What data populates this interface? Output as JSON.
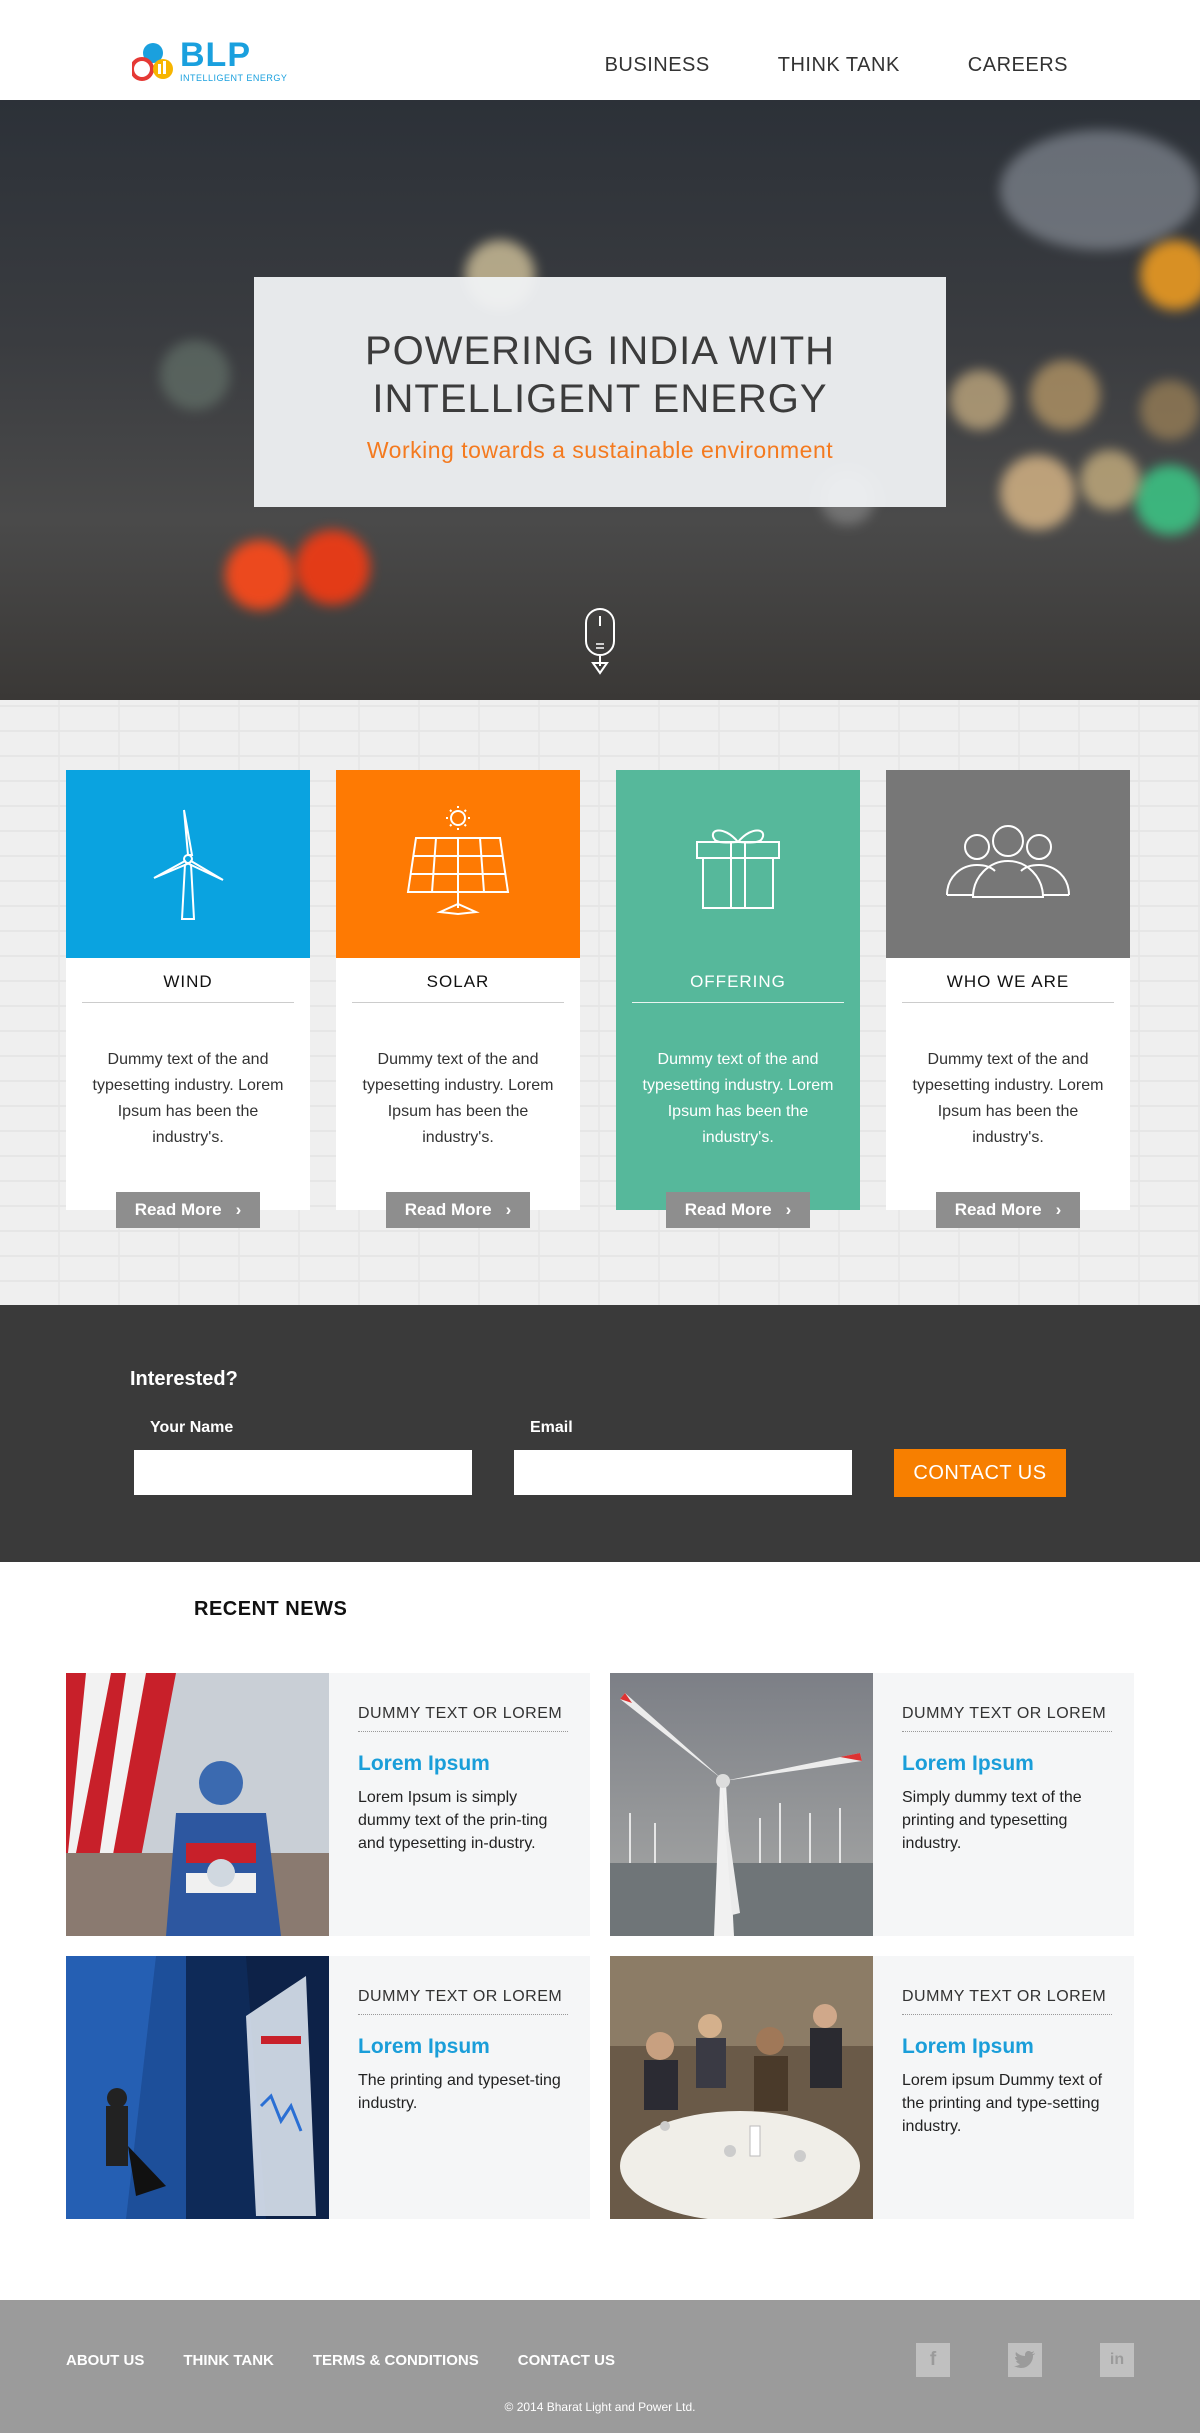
{
  "header": {
    "logo_text": "BLP",
    "logo_sub": "INTELLIGENT ENERGY",
    "nav": [
      "BUSINESS",
      "THINK TANK",
      "CAREERS"
    ]
  },
  "hero": {
    "title_line1": "POWERING INDIA WITH",
    "title_line2": "INTELLIGENT ENERGY",
    "subtitle": "Working towards a sustainable environment",
    "scroll_icon": "mouse-scroll-icon"
  },
  "services": [
    {
      "title": "WIND",
      "text": "Dummy text of the  and typesetting industry. Lorem Ipsum has been the industry's.",
      "button": "Read More",
      "color": "#0aa3e0",
      "icon": "wind-turbine-icon"
    },
    {
      "title": "SOLAR",
      "text": "Dummy text of the  and typesetting industry. Lorem Ipsum has been the industry's.",
      "button": "Read More",
      "color": "#fe7a03",
      "icon": "solar-panel-icon"
    },
    {
      "title": "OFFERING",
      "text": "Dummy text of the  and typesetting industry. Lorem Ipsum has been the industry's.",
      "button": "Read More",
      "color": "#56b89b",
      "icon": "gift-icon"
    },
    {
      "title": "WHO WE ARE",
      "text": "Dummy text of the  and typesetting industry. Lorem Ipsum has been the industry's.",
      "button": "Read More",
      "color": "#777777",
      "icon": "people-icon"
    }
  ],
  "contact": {
    "heading": "Interested?",
    "name_label": "Your Name",
    "email_label": "Email",
    "button": "CONTACT US"
  },
  "news": {
    "heading": "RECENT NEWS",
    "items": [
      {
        "tag": "DUMMY TEXT OR LOREM",
        "title": "Lorem Ipsum",
        "text": "Lorem Ipsum is simply dummy text of the prin-ting and typesetting in-dustry."
      },
      {
        "tag": "DUMMY TEXT OR LOREM",
        "title": "Lorem Ipsum",
        "text": "Simply dummy text of the printing and typesetting industry."
      },
      {
        "tag": "DUMMY TEXT OR LOREM",
        "title": "Lorem Ipsum",
        "text": "The printing and typeset-ting industry."
      },
      {
        "tag": "DUMMY TEXT OR LOREM",
        "title": "Lorem Ipsum",
        "text": "Lorem ipsum Dummy text of the printing and type-setting industry."
      }
    ]
  },
  "footer": {
    "links": [
      "ABOUT US",
      "THINK TANK",
      "TERMS & CONDITIONS",
      "CONTACT US"
    ],
    "social": [
      "facebook-icon",
      "twitter-icon",
      "linkedin-icon"
    ],
    "copyright": "© 2014 Bharat Light and Power Ltd."
  }
}
